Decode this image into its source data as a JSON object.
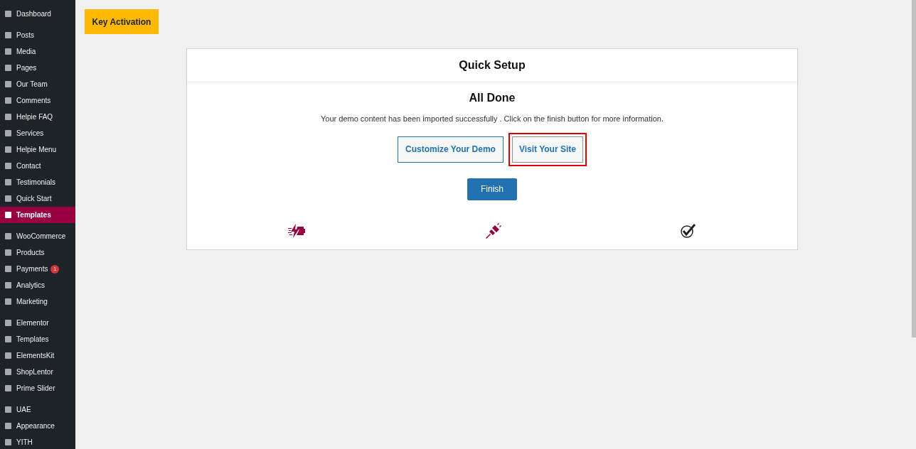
{
  "sidebar": {
    "groups": [
      [
        {
          "label": "Dashboard",
          "selected": false
        }
      ],
      [
        {
          "label": "Posts",
          "selected": false
        },
        {
          "label": "Media",
          "selected": false
        },
        {
          "label": "Pages",
          "selected": false
        },
        {
          "label": "Our Team",
          "selected": false
        },
        {
          "label": "Comments",
          "selected": false
        },
        {
          "label": "Helpie FAQ",
          "selected": false
        },
        {
          "label": "Services",
          "selected": false
        },
        {
          "label": "Helpie Menu",
          "selected": false
        },
        {
          "label": "Contact",
          "selected": false
        },
        {
          "label": "Testimonials",
          "selected": false
        },
        {
          "label": "Quick Start",
          "selected": false
        },
        {
          "label": "Templates",
          "selected": true
        }
      ],
      [
        {
          "label": "WooCommerce",
          "selected": false
        },
        {
          "label": "Products",
          "selected": false
        },
        {
          "label": "Payments",
          "selected": false,
          "badge": "1"
        },
        {
          "label": "Analytics",
          "selected": false
        },
        {
          "label": "Marketing",
          "selected": false
        }
      ],
      [
        {
          "label": "Elementor",
          "selected": false
        },
        {
          "label": "Templates",
          "selected": false
        },
        {
          "label": "ElementsKit",
          "selected": false
        },
        {
          "label": "ShopLentor",
          "selected": false
        },
        {
          "label": "Prime Slider",
          "selected": false
        }
      ],
      [
        {
          "label": "UAE",
          "selected": false
        },
        {
          "label": "Appearance",
          "selected": false
        },
        {
          "label": "YITH",
          "selected": false
        }
      ]
    ]
  },
  "key_activation_button": "Key Activation",
  "setup_card": {
    "title": "Quick Setup",
    "heading": "All Done",
    "message": "Your demo content has been imported successfully . Click on the finish button for more information.",
    "buttons": [
      {
        "label": "Customize Your Demo",
        "highlighted": false
      },
      {
        "label": "Visit Your Site",
        "highlighted": true
      }
    ],
    "finish_button": "Finish"
  }
}
